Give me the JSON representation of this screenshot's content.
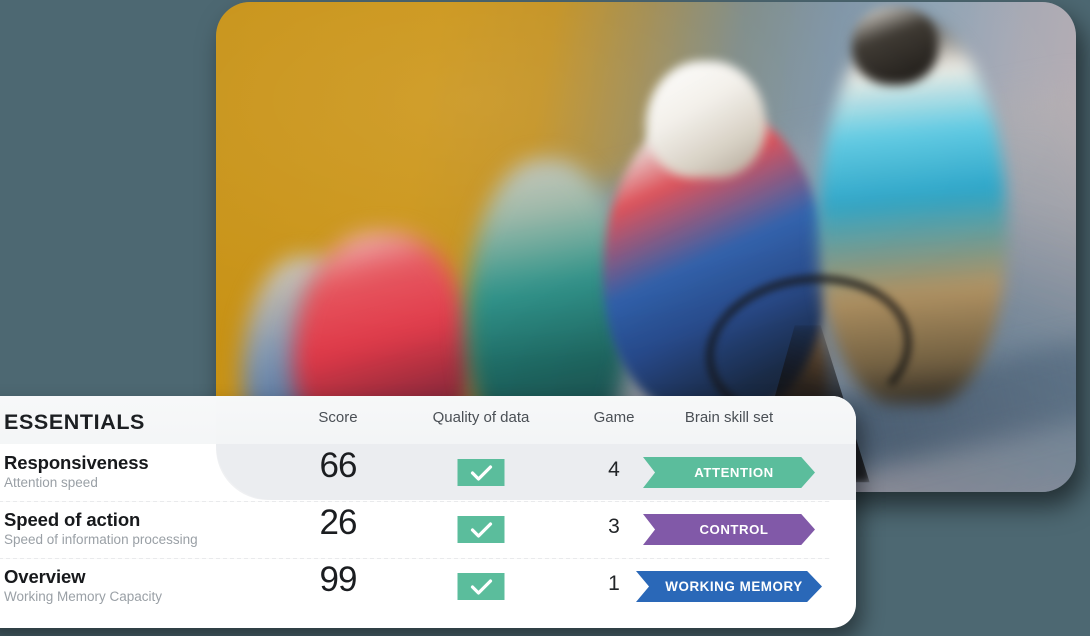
{
  "theme": {
    "background": "#4d6872",
    "card_background": "#ffffff",
    "accent_green": "#5bbd9c",
    "accent_purple": "#8159a8",
    "accent_blue": "#2a68b8",
    "text_primary": "#17191c",
    "text_muted": "#9aa0a6"
  },
  "hero": {
    "alt": "Motion-blurred track cyclists racing on a velodrome",
    "image_name": "track-cycling-photo"
  },
  "table": {
    "title": "ESSENTIALS",
    "columns": [
      {
        "key": "name",
        "label": ""
      },
      {
        "key": "score",
        "label": "Score"
      },
      {
        "key": "quality",
        "label": "Quality of data"
      },
      {
        "key": "game",
        "label": "Game"
      },
      {
        "key": "skill",
        "label": "Brain skill set"
      }
    ],
    "rows": [
      {
        "name": "Responsiveness",
        "subtitle": "Attention speed",
        "score": "66",
        "quality": "check",
        "quality_label": "Good",
        "game": "4",
        "skill": "ATTENTION",
        "skill_color": "#5bbd9c"
      },
      {
        "name": "Speed of action",
        "subtitle": "Speed of information processing",
        "score": "26",
        "quality": "check",
        "quality_label": "Good",
        "game": "3",
        "skill": "CONTROL",
        "skill_color": "#8159a8"
      },
      {
        "name": "Overview",
        "subtitle": "Working Memory Capacity",
        "score": "99",
        "quality": "check",
        "quality_label": "Good",
        "game": "1",
        "skill": "WORKING MEMORY",
        "skill_color": "#2a68b8"
      }
    ]
  }
}
